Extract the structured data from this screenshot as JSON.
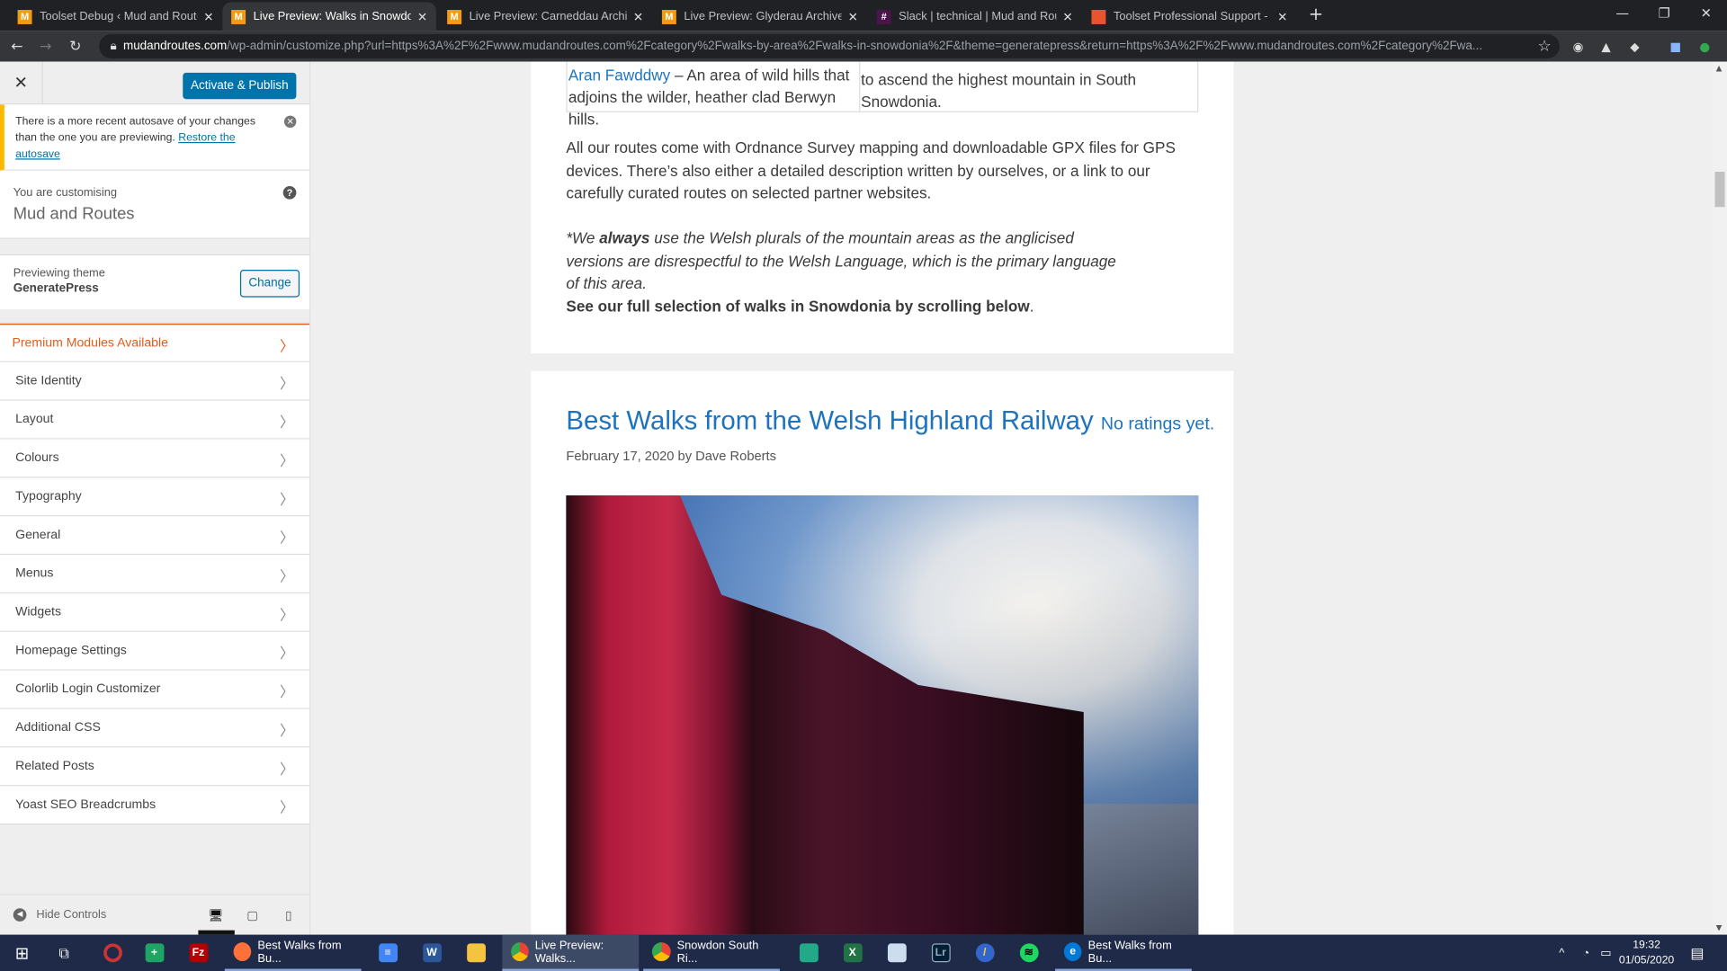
{
  "browser": {
    "tabs": [
      {
        "title": "Toolset Debug ‹ Mud and Routes",
        "icon": "mud-and-routes-icon",
        "active": false
      },
      {
        "title": "Live Preview: Walks in Snowdonia",
        "icon": "mud-and-routes-icon",
        "active": true
      },
      {
        "title": "Live Preview: Carneddau Archives",
        "icon": "mud-and-routes-icon",
        "active": false
      },
      {
        "title": "Live Preview: Glyderau Archives |",
        "icon": "mud-and-routes-icon",
        "active": false
      },
      {
        "title": "Slack | technical | Mud and Routes",
        "icon": "slack-icon",
        "active": false
      },
      {
        "title": "Toolset Professional Support - To",
        "icon": "toolset-icon",
        "active": false
      }
    ],
    "url_domain": "mudandroutes.com",
    "url_path": "/wp-admin/customize.php?url=https%3A%2F%2Fwww.mudandroutes.com%2Fcategory%2Fwalks-by-area%2Fwalks-in-snowdonia%2F&theme=generatepress&return=https%3A%2F%2Fwww.mudandroutes.com%2Fcategory%2Fwa..."
  },
  "sidebar": {
    "publish_label": "Activate & Publish",
    "notice_text": "There is a more recent autosave of your changes than the one you are previewing.",
    "notice_link": "Restore the autosave",
    "customising_label": "You are customising",
    "site_name": "Mud and Routes",
    "theme_label": "Previewing theme",
    "theme_name": "GeneratePress",
    "change_label": "Change",
    "premium_label": "Premium Modules Available",
    "items": [
      "Site Identity",
      "Layout",
      "Colours",
      "Typography",
      "General",
      "Menus",
      "Widgets",
      "Homepage Settings",
      "Colorlib Login Customizer",
      "Additional CSS",
      "Related Posts",
      "Yoast SEO Breadcrumbs"
    ],
    "hide_controls": "Hide Controls",
    "accent": "#0073aa",
    "premium_color": "#e35b19"
  },
  "preview": {
    "table": {
      "c1_link": "Aran Fawddwy",
      "c1_text": " – An area of wild hills that adjoins the wilder, heather clad Berwyn hills.",
      "c2_text": "to ascend the highest mountain in South Snowdonia."
    },
    "para1": "All our routes come with Ordnance Survey mapping and downloadable GPX files for GPS devices. There’s also either a detailed description written by ourselves, or a link to our carefully curated routes on selected partner websites.",
    "para2_a": "*We ",
    "para2_bold": "always",
    "para2_b": " use the Welsh plurals of the mountain areas as the anglicised versions are disrespectful to the Welsh Language, which is the primary language of this area.",
    "para3_bold": "See our full selection of walks in Snowdonia by scrolling below",
    "para3_end": ".",
    "post_title": "Best Walks from the Welsh Highland Railway",
    "rating": "No ratings yet.",
    "post_meta": "February 17, 2020 by Dave Roberts",
    "link_color": "#1e73be"
  },
  "taskbar": {
    "apps": [
      {
        "label": "Best Walks from Bu...",
        "icon": "firefox-icon"
      },
      {
        "label": "Live Preview: Walks...",
        "icon": "chrome-icon",
        "active": true
      },
      {
        "label": "Snowdon South Ri...",
        "icon": "chrome-icon"
      },
      {
        "label": "Best Walks from Bu...",
        "icon": "edge-icon"
      }
    ],
    "time": "19:32",
    "date": "01/05/2020"
  }
}
